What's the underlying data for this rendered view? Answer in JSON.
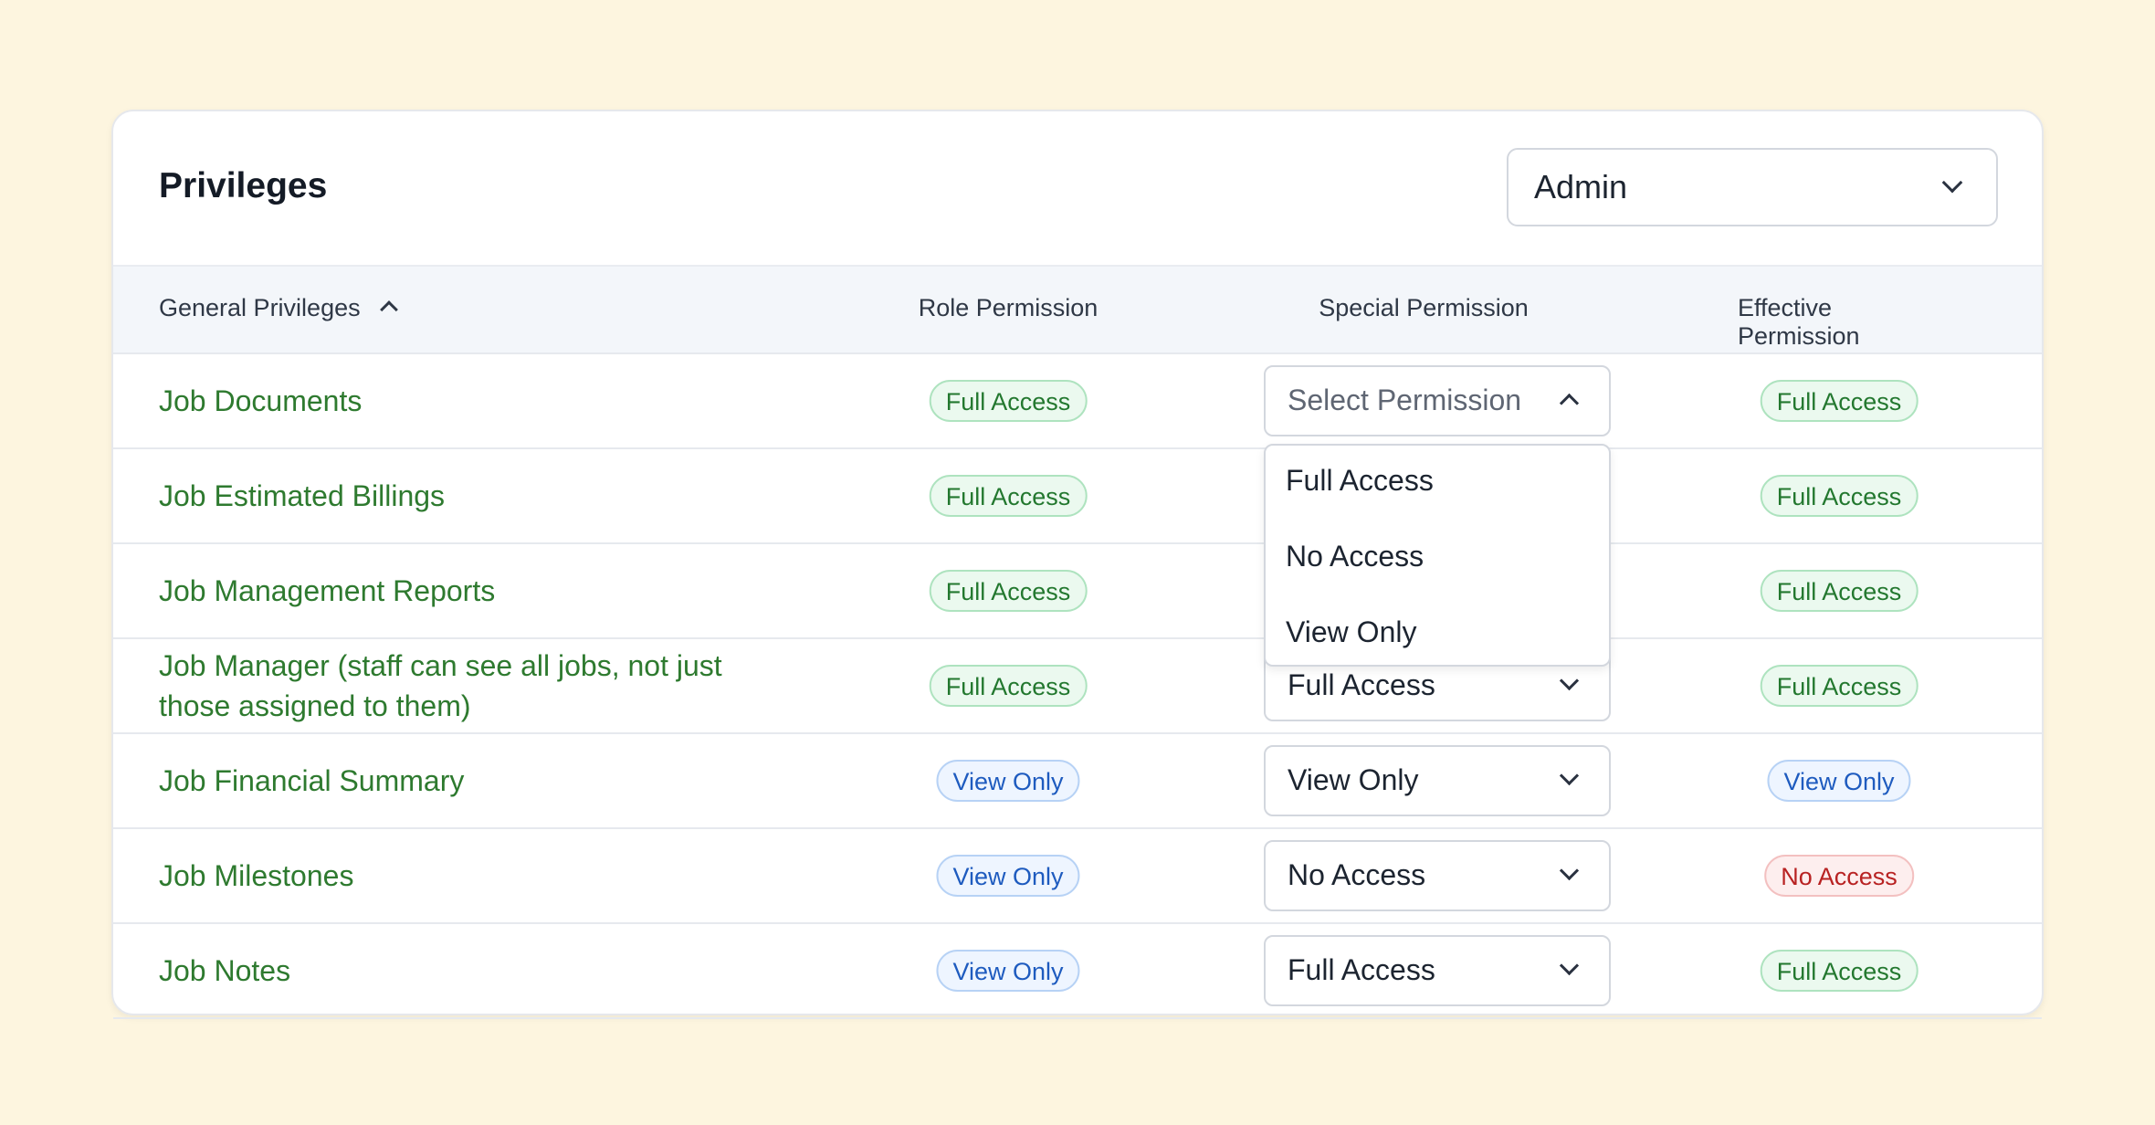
{
  "header": {
    "title": "Privileges",
    "role_select": "Admin"
  },
  "columns": {
    "general": "General Privileges",
    "role": "Role Permission",
    "special": "Special Permission",
    "effective": "Effective Permission"
  },
  "rows": [
    {
      "name": "Job Documents",
      "role": "Full Access",
      "special": "Select Permission",
      "effective": "Full Access"
    },
    {
      "name": "Job Estimated Billings",
      "role": "Full Access",
      "special": "",
      "effective": "Full Access"
    },
    {
      "name": "Job Management Reports",
      "role": "Full Access",
      "special": "",
      "effective": "Full Access"
    },
    {
      "name": "Job Manager (staff can see all jobs, not just those assigned to them)",
      "role": "Full Access",
      "special": "Full Access",
      "effective": "Full Access"
    },
    {
      "name": "Job Financial Summary",
      "role": "View Only",
      "special": "View Only",
      "effective": "View Only"
    },
    {
      "name": "Job Milestones",
      "role": "View Only",
      "special": "No Access",
      "effective": "No Access"
    },
    {
      "name": "Job Notes",
      "role": "View Only",
      "special": "Full Access",
      "effective": "Full Access"
    }
  ],
  "dropdown_options": [
    "Full Access",
    "No Access",
    "View Only"
  ],
  "colors": {
    "background": "#fdf5df",
    "link_green": "#2e7a2f",
    "full_access": "#23782f",
    "view_only": "#1e5bbf",
    "no_access": "#b82222"
  }
}
